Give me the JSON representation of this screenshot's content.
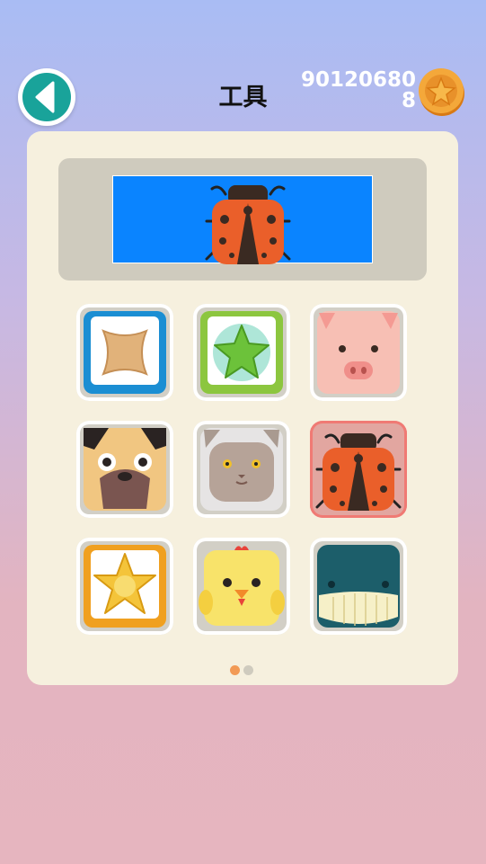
{
  "header": {
    "title": "工具",
    "coin_amount": "901206808"
  },
  "preview": {
    "selected_skin": "ladybug"
  },
  "skins": [
    {
      "name": "tan-tile",
      "selected": false
    },
    {
      "name": "green-star",
      "selected": false
    },
    {
      "name": "pig",
      "selected": false
    },
    {
      "name": "pug",
      "selected": false
    },
    {
      "name": "cat",
      "selected": false
    },
    {
      "name": "ladybug",
      "selected": true
    },
    {
      "name": "gold-star",
      "selected": false
    },
    {
      "name": "chick",
      "selected": false
    },
    {
      "name": "whale",
      "selected": false
    }
  ],
  "pagination": {
    "current_page": 1,
    "total_pages": 2
  },
  "colors": {
    "accent": "#19a39a",
    "preview_bg": "#0a84ff",
    "panel": "#f6f0de",
    "active_dot": "#f29a55"
  }
}
